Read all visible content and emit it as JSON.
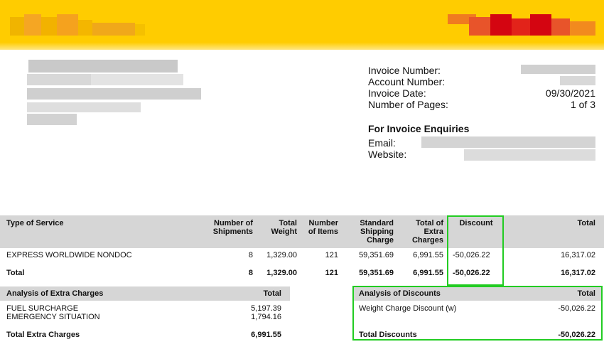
{
  "brand": {
    "colors": {
      "yellow": "#ffcc00",
      "red": "#d40511",
      "highlight": "#22cc22"
    }
  },
  "invoice_info": {
    "labels": {
      "invoice_number": "Invoice Number:",
      "account_number": "Account Number:",
      "invoice_date": "Invoice Date:",
      "number_of_pages": "Number of Pages:"
    },
    "invoice_date": "09/30/2021",
    "number_of_pages": "1 of 3"
  },
  "enquiries": {
    "title": "For Invoice Enquiries",
    "email_label": "Email:",
    "website_label": "Website:"
  },
  "service_table": {
    "headers": {
      "type": "Type of Service",
      "shipments_1": "Number of",
      "shipments_2": "Shipments",
      "weight_1": "Total",
      "weight_2": "Weight",
      "items_1": "Number",
      "items_2": "of Items",
      "std_1": "Standard",
      "std_2": "Shipping",
      "std_3": "Charge",
      "extra_1": "Total of",
      "extra_2": "Extra",
      "extra_3": "Charges",
      "discount": "Discount",
      "total": "Total"
    },
    "rows": [
      {
        "type": "EXPRESS WORLDWIDE NONDOC",
        "shipments": "8",
        "weight": "1,329.00",
        "items": "121",
        "std": "59,351.69",
        "extra": "6,991.55",
        "discount": "-50,026.22",
        "total": "16,317.02"
      }
    ],
    "total_row": {
      "label": "Total",
      "shipments": "8",
      "weight": "1,329.00",
      "items": "121",
      "std": "59,351.69",
      "extra": "6,991.55",
      "discount": "-50,026.22",
      "total": "16,317.02"
    }
  },
  "extra_charges": {
    "title": "Analysis of Extra Charges",
    "total_header": "Total",
    "items": [
      {
        "label": "FUEL SURCHARGE",
        "value": "5,197.39"
      },
      {
        "label": "EMERGENCY SITUATION",
        "value": "1,794.16"
      }
    ],
    "total_label": "Total Extra Charges",
    "total_value": "6,991.55"
  },
  "discounts": {
    "title": "Analysis of Discounts",
    "total_header": "Total",
    "items": [
      {
        "label": "Weight Charge Discount (w)",
        "value": "-50,026.22"
      }
    ],
    "total_label": "Total Discounts",
    "total_value": "-50,026.22"
  }
}
